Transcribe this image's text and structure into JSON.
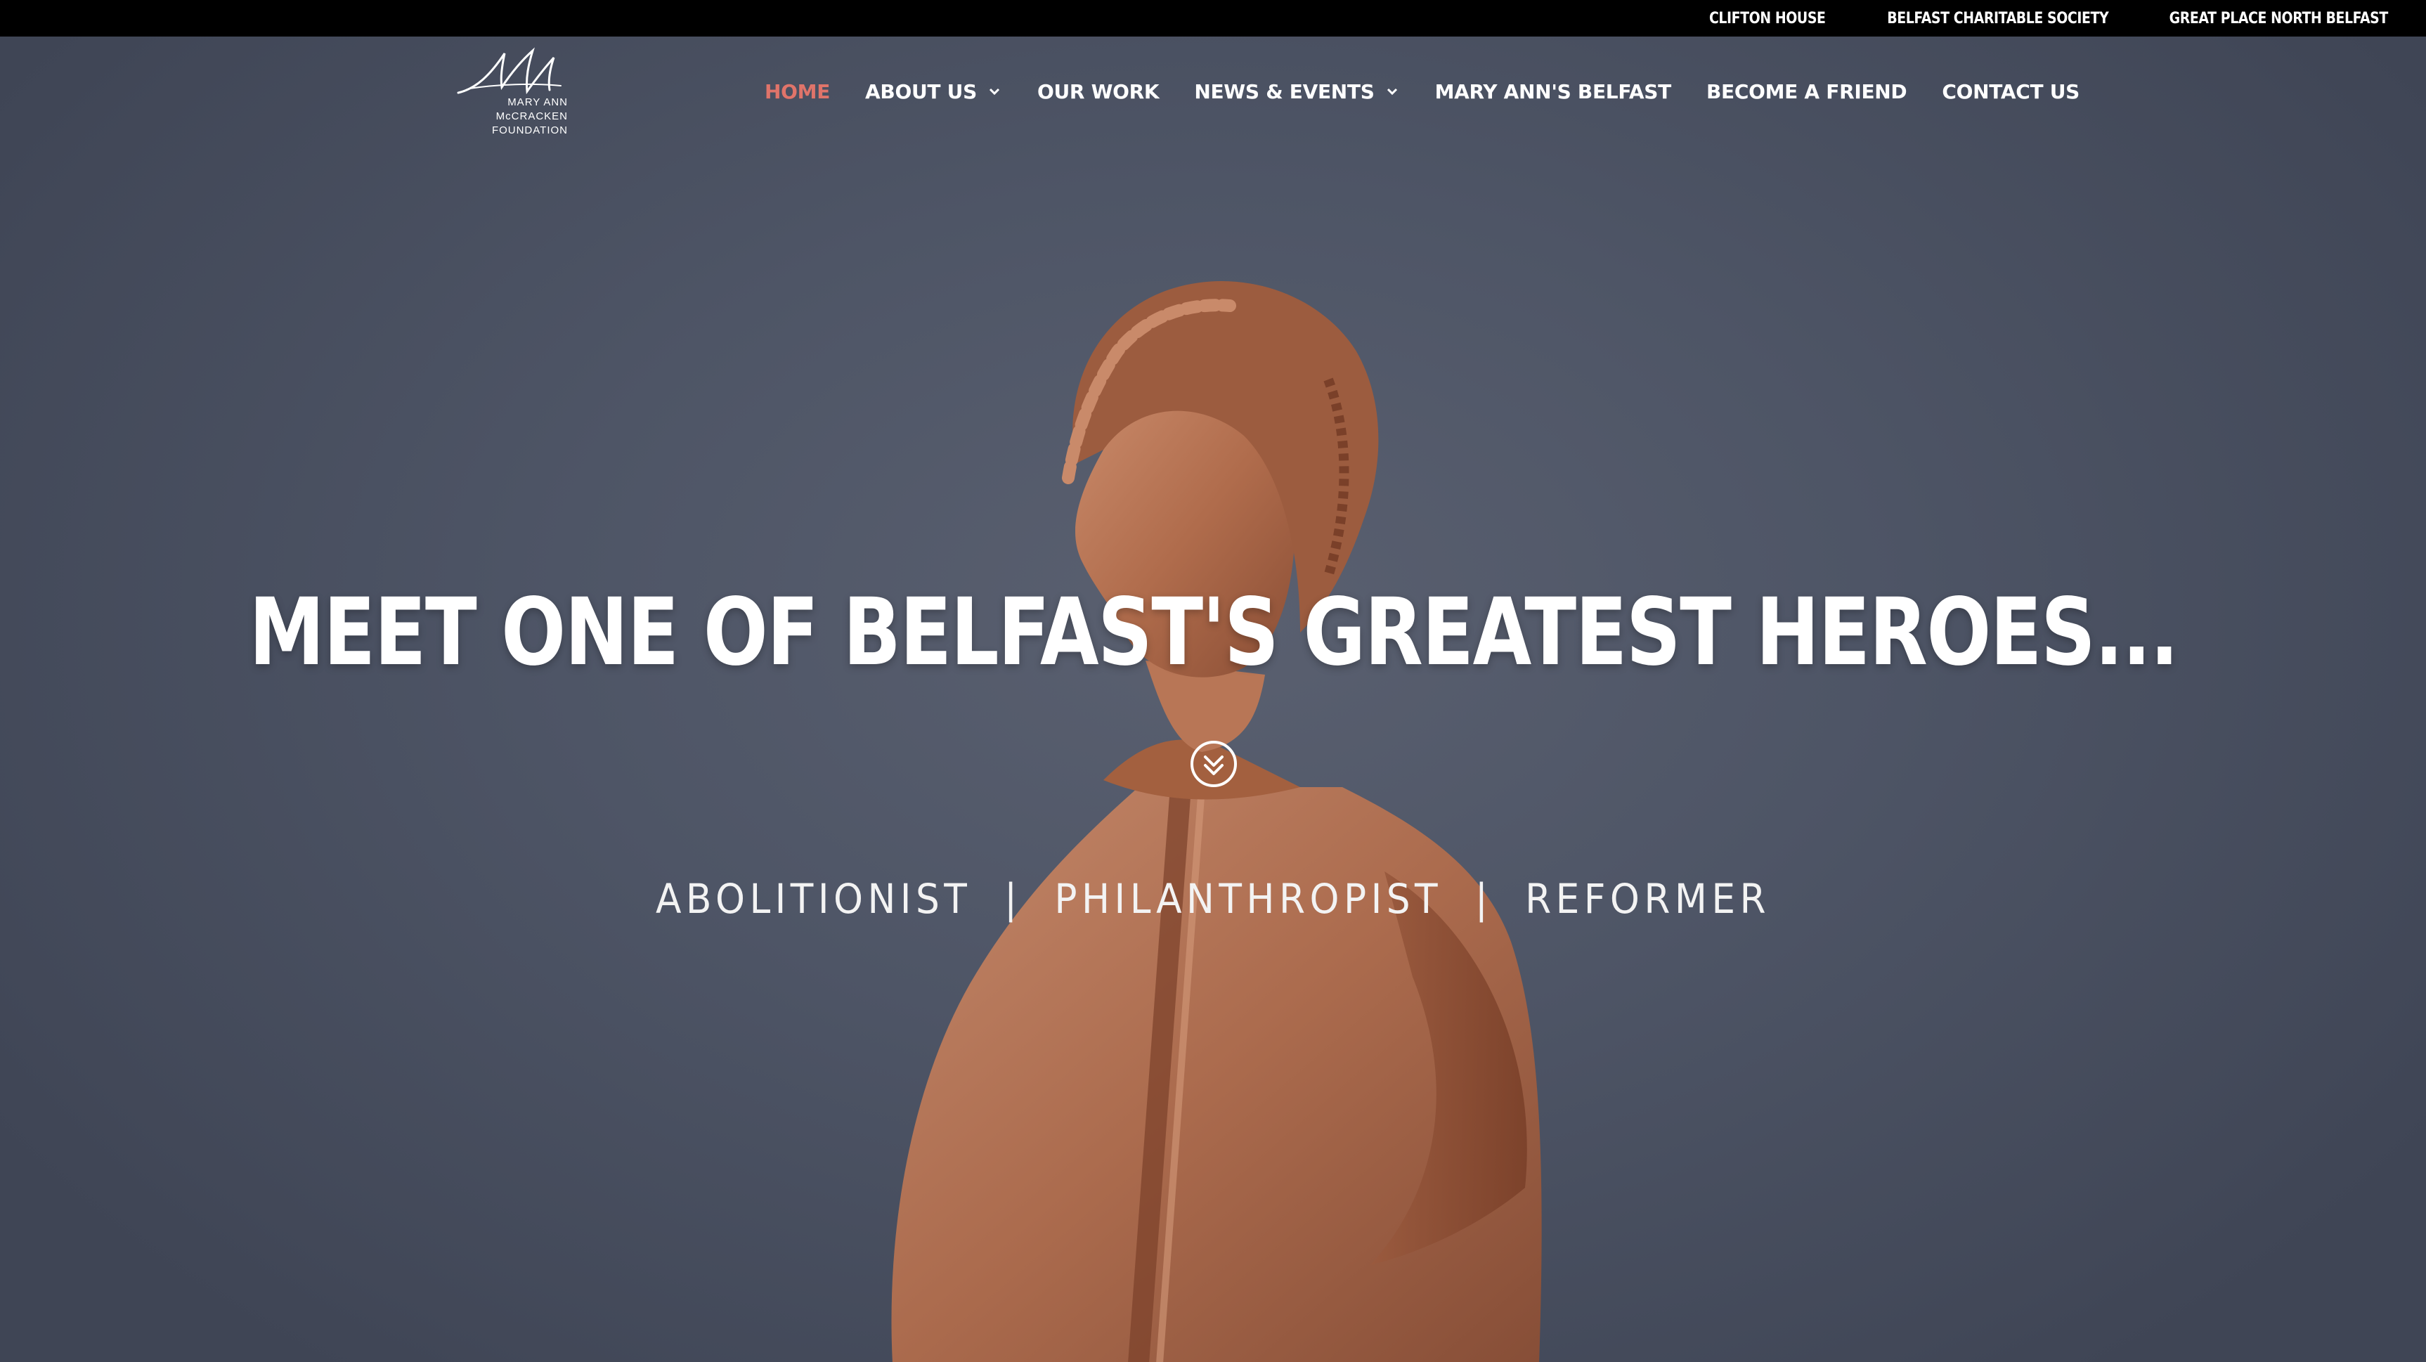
{
  "top_bar": {
    "links": [
      "CLIFTON HOUSE",
      "BELFAST CHARITABLE SOCIETY",
      "GREAT PLACE NORTH BELFAST"
    ]
  },
  "logo": {
    "line1": "MARY ANN",
    "line2": "McCRACKEN",
    "line3": "FOUNDATION"
  },
  "nav": {
    "items": [
      {
        "label": "HOME",
        "active": true
      },
      {
        "label": "ABOUT US",
        "dropdown": true
      },
      {
        "label": "OUR WORK"
      },
      {
        "label": "NEWS & EVENTS",
        "dropdown": true
      },
      {
        "label": "MARY ANN'S BELFAST"
      },
      {
        "label": "BECOME A FRIEND"
      },
      {
        "label": "CONTACT US"
      }
    ],
    "active_color": "#e0746a"
  },
  "hero": {
    "headline": "MEET ONE OF BELFAST'S GREATEST HEROES...",
    "scroll_icon": "double-chevron-down-circle-icon",
    "tagline": "ABOLITIONIST  |  PHILANTHROPIST  |  REFORMER"
  },
  "colors": {
    "background": "#4e5566",
    "top_bar": "#000000",
    "statue": "#b5704f"
  }
}
